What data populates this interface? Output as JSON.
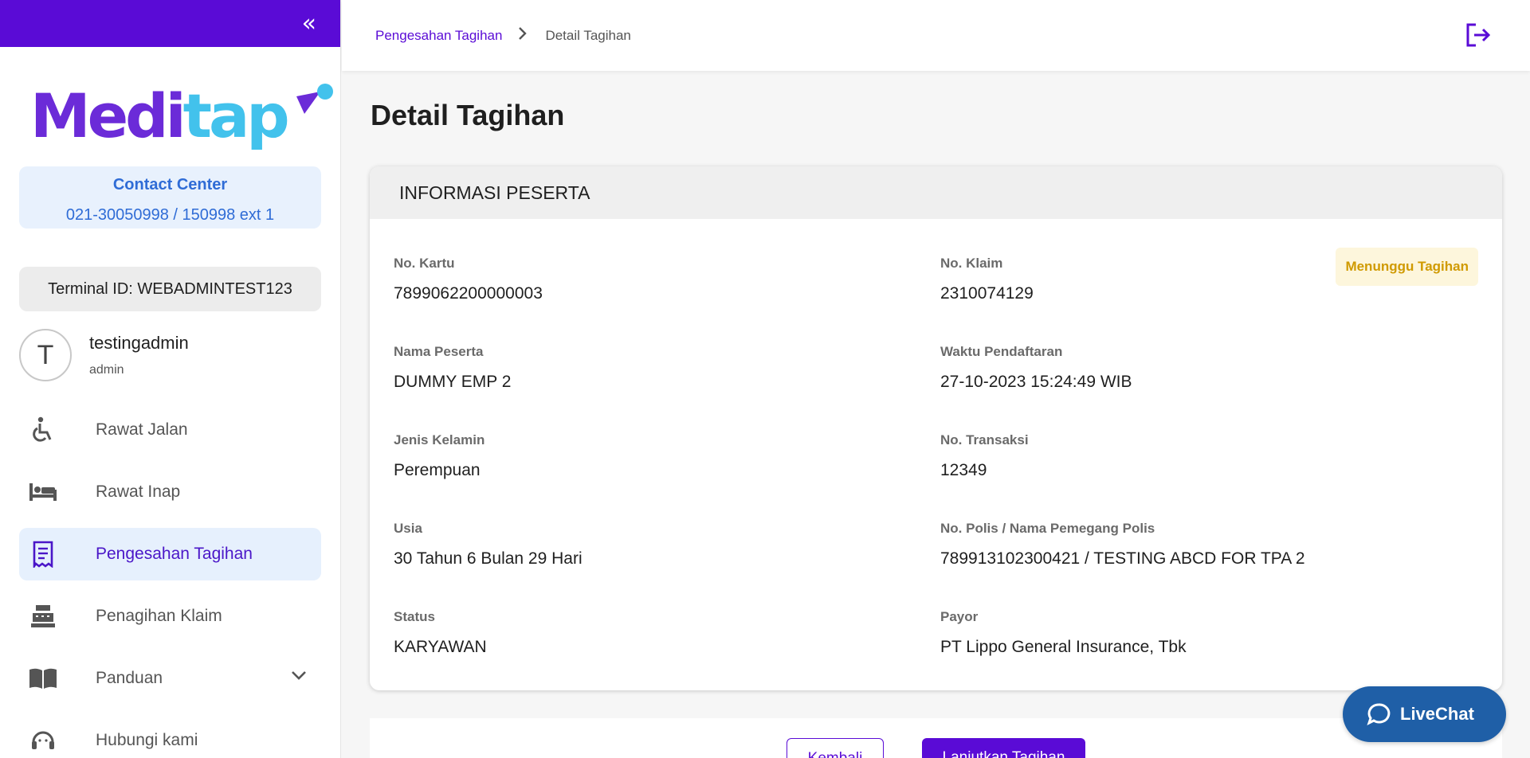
{
  "sidebar": {
    "logo": {
      "part1": "Medi",
      "part2": "tap"
    },
    "contact": {
      "title": "Contact Center",
      "phone": "021-30050998 / 150998 ext 1"
    },
    "terminal": "Terminal ID: WEBADMINTEST123",
    "user": {
      "initial": "T",
      "name": "testingadmin",
      "role": "admin"
    },
    "items": [
      {
        "label": "Rawat Jalan",
        "icon": "wheelchair-icon"
      },
      {
        "label": "Rawat Inap",
        "icon": "bed-icon"
      },
      {
        "label": "Pengesahan Tagihan",
        "icon": "receipt-icon",
        "active": true
      },
      {
        "label": "Penagihan Klaim",
        "icon": "cash-register-icon"
      },
      {
        "label": "Panduan",
        "icon": "book-icon"
      },
      {
        "label": "Hubungi kami",
        "icon": "headset-icon"
      }
    ]
  },
  "header": {
    "breadcrumb": {
      "parent": "Pengesahan Tagihan",
      "current": "Detail Tagihan"
    }
  },
  "page": {
    "title": "Detail Tagihan"
  },
  "card": {
    "title": "INFORMASI PESERTA",
    "status_badge": "Menunggu Tagihan",
    "fields": {
      "no_kartu": {
        "label": "No. Kartu",
        "value": "7899062200000003"
      },
      "no_klaim": {
        "label": "No. Klaim",
        "value": "2310074129"
      },
      "nama_peserta": {
        "label": "Nama Peserta",
        "value": "DUMMY EMP 2"
      },
      "waktu_pendaftaran": {
        "label": "Waktu Pendaftaran",
        "value": "27-10-2023 15:24:49 WIB"
      },
      "jenis_kelamin": {
        "label": "Jenis Kelamin",
        "value": "Perempuan"
      },
      "no_transaksi": {
        "label": "No. Transaksi",
        "value": "12349"
      },
      "usia": {
        "label": "Usia",
        "value": "30 Tahun 6 Bulan 29 Hari"
      },
      "no_polis": {
        "label": "No. Polis / Nama Pemegang Polis",
        "value": "789913102300421 / TESTING ABCD FOR TPA 2"
      },
      "status": {
        "label": "Status",
        "value": "KARYAWAN"
      },
      "payor": {
        "label": "Payor",
        "value": "PT Lippo General Insurance, Tbk"
      }
    }
  },
  "actions": {
    "back_label": "Kembali",
    "next_label": "Lanjutkan Tagihan"
  },
  "livechat": {
    "label": "LiveChat"
  },
  "colors": {
    "primary": "#5a0bd6",
    "accent": "#42c2ec",
    "badge_bg": "#fdf6dc",
    "badge_text": "#d09a00",
    "livechat": "#1f5fa7"
  }
}
